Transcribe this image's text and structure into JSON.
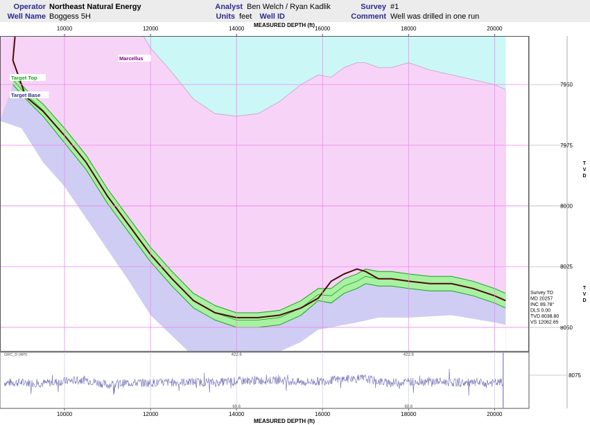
{
  "header": {
    "operator_label": "Operator",
    "operator_value": "Northeast Natural Energy",
    "well_name_label": "Well Name",
    "well_name_value": "Boggess 5H",
    "analyst_label": "Analyst",
    "analyst_value": "Ben Welch / Ryan Kadlik",
    "units_label": "Units",
    "units_value": "feet",
    "well_id_label": "Well ID",
    "well_id_value": "",
    "survey_label": "Survey",
    "survey_value": "#1",
    "comment_label": "Comment",
    "comment_value": "Well was drilled in one run"
  },
  "colors": {
    "above_marcellus": "#ccf7f7",
    "marcellus": "#f7d4f7",
    "below_target": "#cfcdf4",
    "target_band": "#a8f0a2",
    "target_line": "#1aa21a",
    "wellpath": "#6a0000",
    "gridline": "#ee88ee",
    "gamma_trace": "#7b7bbb",
    "label_accent": "#2b2b8f"
  },
  "chart_data": [
    {
      "type": "line",
      "title": "",
      "xlabel": "MEASURED DEPTH (ft)",
      "ylabel": "TVD",
      "xlim": [
        8500,
        20800
      ],
      "ylim": [
        7930,
        8060
      ],
      "y_inverted": true,
      "x_ticks": [
        "10000",
        "12000",
        "14000",
        "16000",
        "18000",
        "20000"
      ],
      "y_ticks": [
        "7950",
        "7975",
        "8000",
        "8025",
        "8050"
      ],
      "x": [
        8800,
        9100,
        9500,
        10000,
        10500,
        11000,
        11500,
        12000,
        12500,
        13000,
        13500,
        14000,
        14500,
        15000,
        15500,
        15900,
        16200,
        16500,
        16800,
        17000,
        17300,
        17600,
        18000,
        18500,
        19000,
        19500,
        20000,
        20257
      ],
      "series": [
        {
          "name": "Marcellus",
          "values": [
            7920,
            7920,
            7920,
            7920,
            7920,
            7920,
            7920,
            7935,
            7945,
            7956,
            7962,
            7963,
            7962,
            7957,
            7950,
            7946,
            7947,
            7943,
            7941,
            7941,
            7943,
            7943,
            7941,
            7944,
            7946,
            7948,
            7950,
            7952
          ]
        },
        {
          "name": "Target Top",
          "values": [
            7946,
            7952,
            7958,
            7968,
            7979,
            7993,
            8005,
            8017,
            8027,
            8036,
            8041,
            8044,
            8044,
            8043,
            8039,
            8034,
            8034,
            8030,
            8028,
            8026,
            8027,
            8027,
            8028,
            8029,
            8029,
            8031,
            8034,
            8036
          ]
        },
        {
          "name": "Target Base",
          "values": [
            7950,
            7956,
            7963,
            7974,
            7985,
            7999,
            8011,
            8023,
            8033,
            8042,
            8047,
            8050,
            8050,
            8049,
            8045,
            8039,
            8040,
            8036,
            8034,
            8032,
            8033,
            8033,
            8034,
            8035,
            8035,
            8037,
            8040,
            8042
          ]
        },
        {
          "name": "Survey",
          "values": [
            7940,
            7955,
            7961,
            7971,
            7982,
            7996,
            8008,
            8020,
            8030,
            8039,
            8044,
            8046,
            8046,
            8045,
            8042,
            8038,
            8031,
            8028,
            8026,
            8027,
            8030,
            8030,
            8031,
            8032,
            8032,
            8034,
            8037,
            8039
          ]
        }
      ],
      "lower_boundary_x": [
        8500,
        9000,
        9500,
        10000,
        10500,
        11000,
        11500,
        12000,
        13000,
        14000,
        15000,
        15500,
        15900,
        16200,
        16800,
        17300,
        18000,
        19000,
        20000,
        20257
      ],
      "lower_boundary_tvd": [
        7965,
        7968,
        7982,
        7992,
        8005,
        8018,
        8031,
        8045,
        8062,
        8061,
        8060,
        8056,
        8051,
        8050,
        8048,
        8046,
        8046,
        8045,
        8048,
        8049
      ],
      "side_label_top": "T\nV\nD",
      "side_label_bottom": "T\nV\nD",
      "layer_labels": [
        "Marcellus",
        "Target Top",
        "Target Base"
      ],
      "survey_td_box": [
        "Survey TD",
        "MD 20257",
        "INC 89.78°",
        "DLS 0.00",
        "TVD 8038.80",
        "VS 12062.65"
      ]
    },
    {
      "type": "line",
      "title": "GRC_D (API)",
      "xlabel": "MEASURED DEPTH (ft)",
      "ylabel": "",
      "xlim": [
        8500,
        20800
      ],
      "scale_max_label": "422.6",
      "scale_min_label": "69.6",
      "right_tick_label": "8075",
      "x_ticks": [
        "10000",
        "12000",
        "14000",
        "16000",
        "18000",
        "20000"
      ],
      "x": [
        8600,
        9000,
        9500,
        10000,
        10500,
        11000,
        11500,
        12000,
        12500,
        13000,
        13500,
        14000,
        14500,
        15000,
        15500,
        16000,
        16500,
        17000,
        17500,
        18000,
        18500,
        19000,
        19500,
        20000,
        20200
      ],
      "series": [
        {
          "name": "GRC_D (API)",
          "values": [
            230,
            232,
            225,
            240,
            250,
            215,
            230,
            228,
            232,
            235,
            230,
            242,
            245,
            248,
            232,
            240,
            255,
            258,
            228,
            236,
            240,
            232,
            226,
            228,
            232
          ]
        }
      ]
    }
  ]
}
